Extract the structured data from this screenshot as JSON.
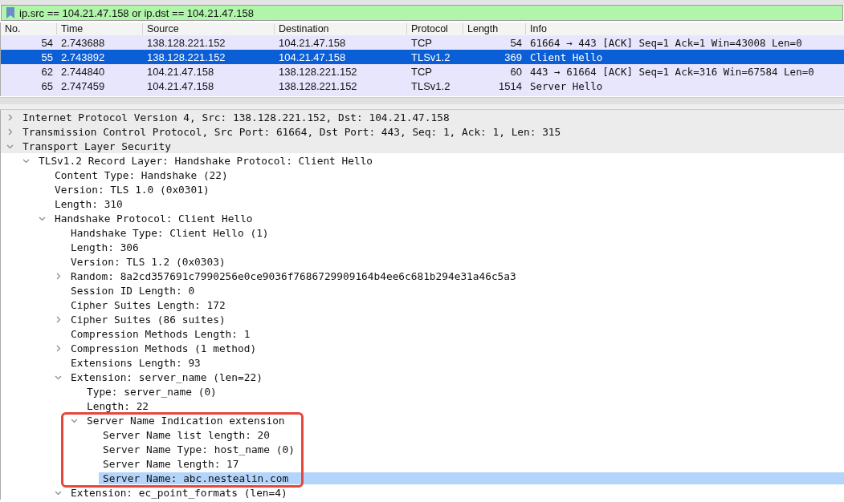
{
  "filter": {
    "value": "ip.src == 104.21.47.158 or ip.dst == 104.21.47.158"
  },
  "packet_list": {
    "columns": [
      "No.",
      "Time",
      "Source",
      "Destination",
      "Protocol",
      "Length",
      "Info"
    ],
    "rows": [
      {
        "no": "54",
        "time": "2.743688",
        "source": "138.128.221.152",
        "destination": "104.21.47.158",
        "protocol": "TCP",
        "length": "54",
        "info": "61664 → 443 [ACK] Seq=1 Ack=1 Win=43008 Len=0",
        "selected": false
      },
      {
        "no": "55",
        "time": "2.743892",
        "source": "138.128.221.152",
        "destination": "104.21.47.158",
        "protocol": "TLSv1.2",
        "length": "369",
        "info": "Client Hello",
        "selected": true
      },
      {
        "no": "62",
        "time": "2.744840",
        "source": "104.21.47.158",
        "destination": "138.128.221.152",
        "protocol": "TCP",
        "length": "60",
        "info": "443 → 61664 [ACK] Seq=1 Ack=316 Win=67584 Len=0",
        "selected": false
      },
      {
        "no": "65",
        "time": "2.747459",
        "source": "104.21.47.158",
        "destination": "138.128.221.152",
        "protocol": "TLSv1.2",
        "length": "1514",
        "info": "Server Hello",
        "selected": false
      }
    ]
  },
  "packet_details": [
    {
      "label": "Internet Protocol Version 4, Src: 138.128.221.152, Dst: 104.21.47.158",
      "expanded": false,
      "selected": false
    },
    {
      "label": "Transmission Control Protocol, Src Port: 61664, Dst Port: 443, Seq: 1, Ack: 1, Len: 315",
      "expanded": false,
      "selected": false
    },
    {
      "label": "Transport Layer Security",
      "expanded": true,
      "selected": false,
      "children": [
        {
          "label": "TLSv1.2 Record Layer: Handshake Protocol: Client Hello",
          "expanded": true,
          "selected": false,
          "children": [
            {
              "label": "Content Type: Handshake (22)",
              "selected": false
            },
            {
              "label": "Version: TLS 1.0 (0x0301)",
              "selected": false
            },
            {
              "label": "Length: 310",
              "selected": false
            },
            {
              "label": "Handshake Protocol: Client Hello",
              "expanded": true,
              "selected": false,
              "children": [
                {
                  "label": "Handshake Type: Client Hello (1)",
                  "selected": false
                },
                {
                  "label": "Length: 306",
                  "selected": false
                },
                {
                  "label": "Version: TLS 1.2 (0x0303)",
                  "selected": false
                },
                {
                  "label": "Random: 8a2cd357691c7990256e0ce9036f7686729909164b4ee6c681b294e31a46c5a3",
                  "expanded": false,
                  "selected": false
                },
                {
                  "label": "Session ID Length: 0",
                  "selected": false
                },
                {
                  "label": "Cipher Suites Length: 172",
                  "selected": false
                },
                {
                  "label": "Cipher Suites (86 suites)",
                  "expanded": false,
                  "selected": false
                },
                {
                  "label": "Compression Methods Length: 1",
                  "selected": false
                },
                {
                  "label": "Compression Methods (1 method)",
                  "expanded": false,
                  "selected": false
                },
                {
                  "label": "Extensions Length: 93",
                  "selected": false
                },
                {
                  "label": "Extension: server_name (len=22)",
                  "expanded": true,
                  "selected": false,
                  "children": [
                    {
                      "label": "Type: server_name (0)",
                      "selected": false
                    },
                    {
                      "label": "Length: 22",
                      "selected": false
                    },
                    {
                      "label": "Server Name Indication extension",
                      "expanded": true,
                      "selected": false,
                      "highlighted": true,
                      "children": [
                        {
                          "label": "Server Name list length: 20",
                          "selected": false
                        },
                        {
                          "label": "Server Name Type: host_name (0)",
                          "selected": false
                        },
                        {
                          "label": "Server Name length: 17",
                          "selected": false
                        },
                        {
                          "label": "Server Name: abc.nestealin.com",
                          "selected": true
                        }
                      ]
                    }
                  ]
                },
                {
                  "label": "Extension: ec_point_formats (len=4)",
                  "expanded": true,
                  "selected": false
                }
              ]
            }
          ]
        }
      ]
    }
  ]
}
